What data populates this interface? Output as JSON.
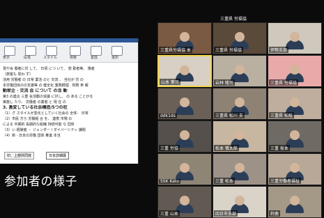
{
  "caption": "参加者の様子",
  "doc": {
    "ribbon_items": [
      "表示",
      "段落",
      "スタイル",
      "検索",
      "置換",
      "選択"
    ],
    "lines": [
      "現や会 働者に対 して、 日頃 につ いて、 想 勤者等、 働者",
      "（旅客も  問わ ず）",
      "活用  労働者  の 日常  業活  のと 交流 、 当社が   労   の",
      "本労働団体のの支援等  の 健全化 業務経理 · 財務 参   報",
      "動家企 · 交流  会 について の活 動",
      "",
      "第3  の連合 三重 会活動の協議 に対し、 の   ある ことがる",
      "実施し  たり、  労働者  の業者   と  現 在   の",
      "",
      "3.  激変している社会構造/5つの柱",
      "（1）グ スタイルが変化としていく社会の   全体： 日常",
      "（2）市民  方ら 労働組 合 を、  連携   市場 の",
      "     による 中期的 長期的な組織   持続可能 な 団体",
      "（3）い    経験者  ・  ジェンダー / ダイバーシティ 課題",
      "（4）新 · 日本の労働  団体     推進  本当"
    ],
    "status": "印、上部共同体",
    "button": "日本詳細展"
  },
  "gallery": {
    "top_label": "三重県 労福協",
    "tiles": [
      {
        "name": "三重県労福協  本",
        "color": "#7a5a43"
      },
      {
        "name": "三重県 労福協",
        "color": "#5a4a3a"
      },
      {
        "name": "伊勢支部",
        "color": "#cfc8bd"
      },
      {
        "name": "山本 憲司",
        "color": "#d8d0c4"
      },
      {
        "name": "岩林 隆司",
        "color": "#b9b0a2"
      },
      {
        "name": "三重県 労福協",
        "color": "#e8a9a9"
      },
      {
        "name": "ddk1ds",
        "color": "#6b6057"
      },
      {
        "name": "三重県 松川 支",
        "color": "#8e8275"
      },
      {
        "name": "三重県 松阪",
        "color": "#bfae9e"
      },
      {
        "name": "三重 労協",
        "color": "#55504b"
      },
      {
        "name": "松本 慎太郎",
        "color": "#c7b6a0"
      },
      {
        "name": "三重 坂本",
        "color": "#6f6a63"
      },
      {
        "name": "SSK Kato",
        "color": "#8f8575"
      },
      {
        "name": "三重 松本",
        "color": "#9c9288"
      },
      {
        "name": "三重労働者福祉",
        "color": "#b7a898"
      },
      {
        "name": "三重 山本",
        "color": "#625a52"
      },
      {
        "name": "四日市支部",
        "color": "#d9d3c8"
      },
      {
        "name": "鈴鹿",
        "color": "#a49887"
      }
    ]
  }
}
